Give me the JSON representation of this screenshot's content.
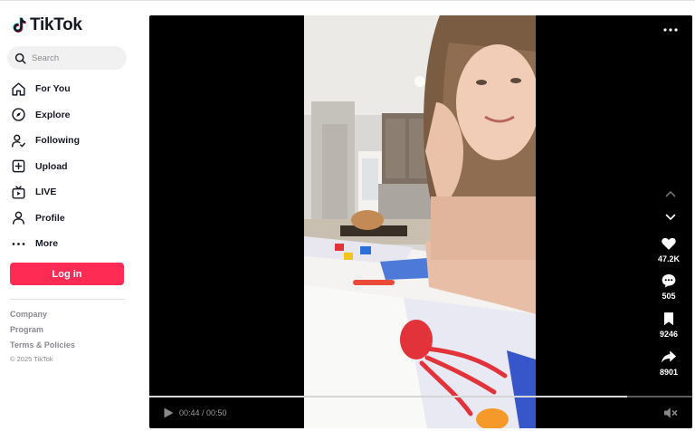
{
  "brand": {
    "name": "TikTok",
    "colors": {
      "accent": "#fe2c55",
      "cyan": "#25f4ee",
      "text": "#161823",
      "muted": "#8a8b91"
    }
  },
  "search": {
    "placeholder": "Search",
    "icon": "search-icon"
  },
  "nav": {
    "items": [
      {
        "label": "For You",
        "icon": "home-icon"
      },
      {
        "label": "Explore",
        "icon": "compass-icon"
      },
      {
        "label": "Following",
        "icon": "following-icon"
      },
      {
        "label": "Upload",
        "icon": "upload-icon"
      },
      {
        "label": "LIVE",
        "icon": "live-icon"
      },
      {
        "label": "Profile",
        "icon": "profile-icon"
      },
      {
        "label": "More",
        "icon": "more-dots-icon"
      }
    ]
  },
  "login_label": "Log in",
  "footer": {
    "links": [
      "Company",
      "Program",
      "Terms & Policies"
    ],
    "copyright": "© 2025 TikTok"
  },
  "player": {
    "actions": {
      "likes": "47.2K",
      "comments": "505",
      "saves": "9246",
      "shares": "8901"
    },
    "time": "00:44 / 00:50",
    "progress": 0.88,
    "muted": true
  }
}
